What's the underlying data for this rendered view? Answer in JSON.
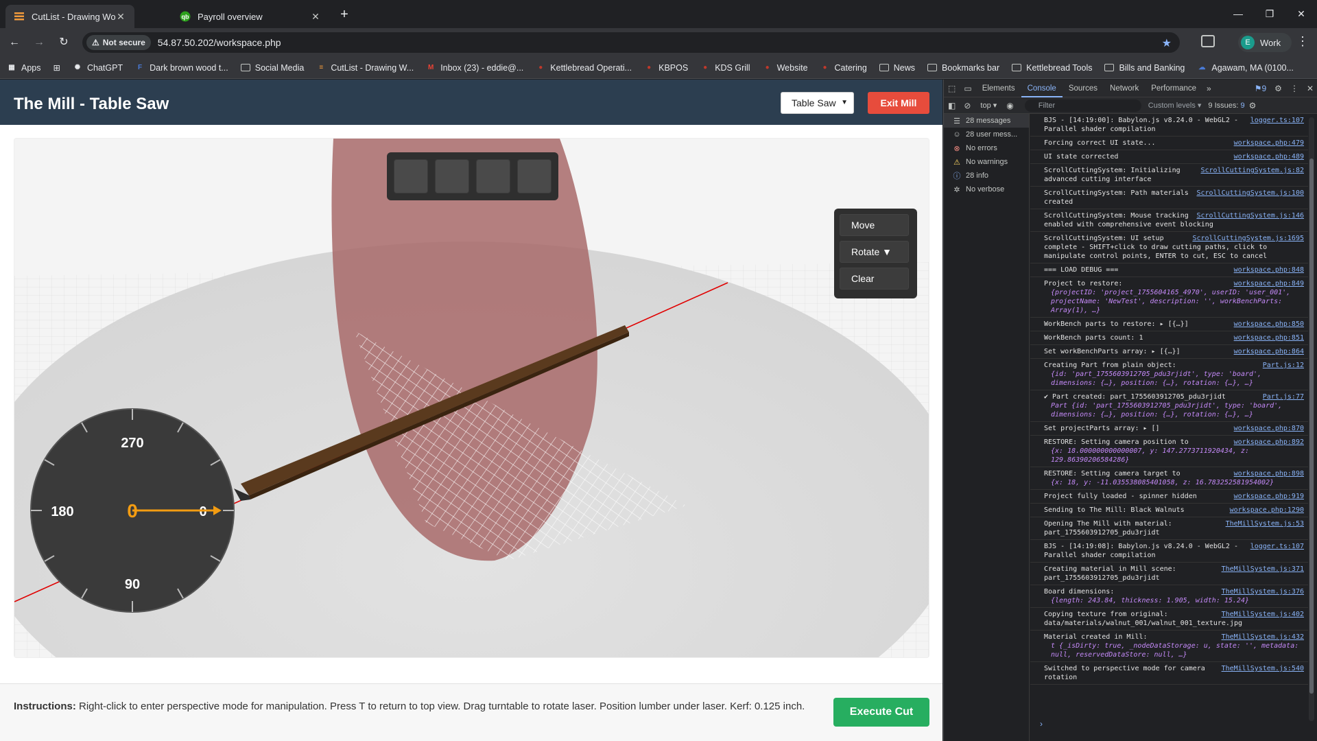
{
  "browser": {
    "tabs": [
      {
        "title": "CutList - Drawing World",
        "active": true
      },
      {
        "title": "Payroll overview",
        "active": false
      }
    ],
    "url": "54.87.50.202/workspace.php",
    "security_label": "Not secure",
    "profile_initial": "E",
    "profile_name": "Work",
    "bookmarks": [
      {
        "label": "Apps",
        "icon": "apps-grid-icon"
      },
      {
        "label": "ChatGPT",
        "icon": "chatgpt-icon"
      },
      {
        "label": "Dark brown wood t...",
        "icon": "f-icon"
      },
      {
        "label": "Social Media",
        "icon": "folder-icon"
      },
      {
        "label": "CutList - Drawing W...",
        "icon": "cutlist-icon"
      },
      {
        "label": "Inbox (23) - eddie@...",
        "icon": "gmail-icon"
      },
      {
        "label": "Kettlebread Operati...",
        "icon": "kettlebread-icon"
      },
      {
        "label": "KBPOS",
        "icon": "kettlebread-icon"
      },
      {
        "label": "KDS Grill",
        "icon": "kettlebread-icon"
      },
      {
        "label": "Website",
        "icon": "kettlebread-icon"
      },
      {
        "label": "Catering",
        "icon": "kettlebread-icon"
      },
      {
        "label": "News",
        "icon": "folder-icon"
      },
      {
        "label": "Bookmarks bar",
        "icon": "folder-icon"
      },
      {
        "label": "Kettlebread Tools",
        "icon": "folder-icon"
      },
      {
        "label": "Bills and Banking",
        "icon": "folder-icon"
      },
      {
        "label": "Agawam, MA (0100...",
        "icon": "weather-icon"
      }
    ]
  },
  "app": {
    "title": "The Mill - Table Saw",
    "tool_select_value": "Table Saw",
    "exit_label": "Exit Mill",
    "control_panel": {
      "move": "Move",
      "rotate": "Rotate ▼",
      "clear": "Clear"
    },
    "dial": {
      "label_top": "270",
      "label_left": "180",
      "label_bottom": "90",
      "label_right": "0",
      "current_angle": "0"
    },
    "instructions_label": "Instructions:",
    "instructions_text": " Right-click to enter perspective mode for manipulation. Press T to return to top view. Drag turntable to rotate laser. Position lumber under laser. Kerf: 0.125 inch.",
    "execute_label": "Execute Cut"
  },
  "devtools": {
    "tabs": [
      "Elements",
      "Console",
      "Sources",
      "Network",
      "Performance"
    ],
    "active_tab": "Console",
    "message_badge": "9",
    "context": "top ▾",
    "filter_placeholder": "Filter",
    "levels": "Custom levels ▾",
    "issues": "9 Issues: ",
    "issues_count": "9",
    "sidebar": [
      {
        "label": "28 messages",
        "icon": "list-icon"
      },
      {
        "label": "28 user mess...",
        "icon": "user-icon"
      },
      {
        "label": "No errors",
        "icon": "error-icon"
      },
      {
        "label": "No warnings",
        "icon": "warning-icon"
      },
      {
        "label": "28 info",
        "icon": "info-icon"
      },
      {
        "label": "No verbose",
        "icon": "verbose-icon"
      }
    ],
    "logs": [
      {
        "text": "BJS - [14:19:00]: Babylon.js v8.24.0 - WebGL2 - Parallel shader compilation",
        "src": "logger.ts:107"
      },
      {
        "text": "Forcing correct UI state...",
        "src": "workspace.php:479"
      },
      {
        "text": "UI state corrected",
        "src": "workspace.php:489"
      },
      {
        "text": "ScrollCuttingSystem: Initializing advanced cutting interface",
        "src": "ScrollCuttingSystem.js:82"
      },
      {
        "text": "ScrollCuttingSystem: Path materials created",
        "src": "ScrollCuttingSystem.js:100"
      },
      {
        "text": "ScrollCuttingSystem: Mouse tracking enabled with comprehensive event blocking",
        "src": "ScrollCuttingSystem.js:146"
      },
      {
        "text": "ScrollCuttingSystem: UI setup complete - SHIFT+click to draw cutting paths, click to manipulate control points, ENTER to cut, ESC to cancel",
        "src": "ScrollCuttingSystem.js:1695"
      },
      {
        "text": "=== LOAD DEBUG ===",
        "src": "workspace.php:848"
      },
      {
        "text": "Project to restore:",
        "src": "workspace.php:849",
        "obj": "{projectID: 'project_1755604165_4970', userID: 'user_001', projectName: 'NewTest', description: '', workBenchParts: Array(1), …}"
      },
      {
        "text": "WorkBench parts to restore: ▸ [{…}]",
        "src": "workspace.php:850"
      },
      {
        "text": "WorkBench parts count: 1",
        "src": "workspace.php:851"
      },
      {
        "text": "Set workBenchParts array: ▸ [{…}]",
        "src": "workspace.php:864"
      },
      {
        "text": "Creating Part from plain object:",
        "src": "Part.js:12",
        "obj": "{id: 'part_1755603912705_pdu3rjidt', type: 'board', dimensions: {…}, position: {…}, rotation: {…}, …}"
      },
      {
        "text": "✔ Part created: part_1755603912705_pdu3rjidt",
        "src": "Part.js:77",
        "obj": "Part {id: 'part_1755603912705_pdu3rjidt', type: 'board', dimensions: {…}, position: {…}, rotation: {…}, …}"
      },
      {
        "text": "Set projectParts array: ▸ []",
        "src": "workspace.php:870"
      },
      {
        "text": "RESTORE: Setting camera position to",
        "src": "workspace.php:892",
        "obj": "{x: 18.000000000000007, y: 147.2773711920434, z: 129.86390206584286}"
      },
      {
        "text": "RESTORE: Setting camera target to",
        "src": "workspace.php:898",
        "obj": "{x: 18, y: -11.035538085401058, z: 16.783252581954002}"
      },
      {
        "text": "Project fully loaded - spinner hidden",
        "src": "workspace.php:919"
      },
      {
        "text": "Sending to The Mill: Black Walnuts",
        "src": "workspace.php:1290"
      },
      {
        "text": "Opening The Mill with material: part_1755603912705_pdu3rjidt",
        "src": "TheMillSystem.js:53"
      },
      {
        "text": "BJS - [14:19:08]: Babylon.js v8.24.0 - WebGL2 - Parallel shader compilation",
        "src": "logger.ts:107"
      },
      {
        "text": "Creating material in Mill scene: part_1755603912705_pdu3rjidt",
        "src": "TheMillSystem.js:371"
      },
      {
        "text": "Board dimensions:",
        "src": "TheMillSystem.js:376",
        "obj": "{length: 243.84, thickness: 1.905, width: 15.24}"
      },
      {
        "text": "Copying texture from original: data/materials/walnut_001/walnut_001_texture.jpg",
        "src": "TheMillSystem.js:402"
      },
      {
        "text": "Material created in Mill:",
        "src": "TheMillSystem.js:432",
        "obj": "t {_isDirty: true, _nodeDataStorage: u, state: '', metadata: null, reservedDataStore: null, …}"
      },
      {
        "text": "Switched to perspective mode for camera rotation",
        "src": "TheMillSystem.js:540"
      }
    ]
  },
  "colors": {
    "header_bg": "#2c3e50",
    "exit_red": "#e74c3c",
    "execute_green": "#27ae60",
    "dial_orange": "#f39c12",
    "laser_red": "#e00000",
    "board_brown": "#5a3a1e",
    "blade_rose": "#a86a6a"
  }
}
